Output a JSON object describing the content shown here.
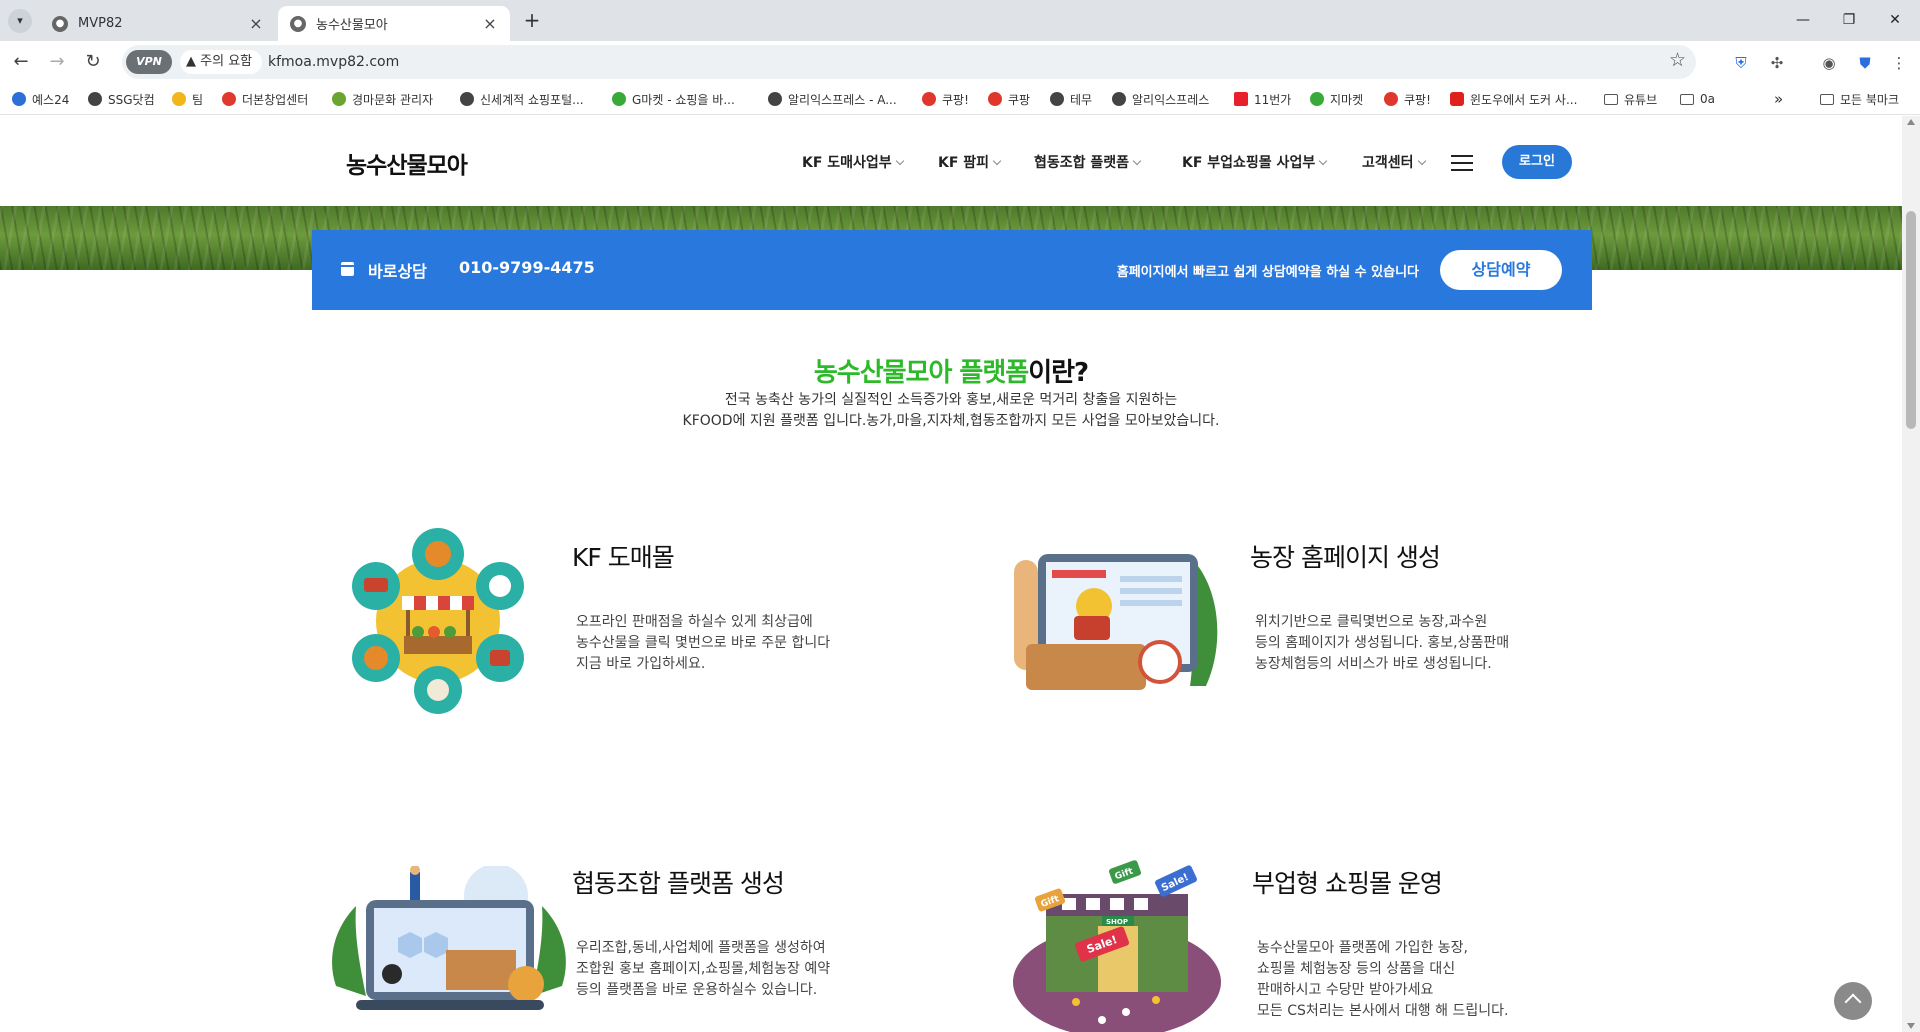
{
  "browser": {
    "tabs": [
      {
        "label": "MVP82",
        "active": false
      },
      {
        "label": "농수산물모아",
        "active": true
      }
    ],
    "address": {
      "vpn_label": "VPN",
      "security_label": "주의 요함",
      "url": "kfmoa.mvp82.com"
    },
    "bookmarks": [
      {
        "label": "예스24",
        "color": "#2d6fd6"
      },
      {
        "label": "SSG닷컴",
        "color": "#444444"
      },
      {
        "label": "팀",
        "color": "#f2b61b"
      },
      {
        "label": "더본창업센터",
        "color": "#e03a2e"
      },
      {
        "label": "경마문화 관리자",
        "color": "#6aa531"
      },
      {
        "label": "신세계적 쇼핑포털...",
        "color": "#444444"
      },
      {
        "label": "G마켓 - 쇼핑을 바...",
        "color": "#39a93a"
      },
      {
        "label": "알리익스프레스 - A...",
        "color": "#444444"
      },
      {
        "label": "쿠팡!",
        "color": "#e0372c"
      },
      {
        "label": "쿠팡",
        "color": "#e0372c"
      },
      {
        "label": "테무",
        "color": "#444444"
      },
      {
        "label": "알리익스프레스",
        "color": "#444444"
      },
      {
        "label": "11번가",
        "color": "#e8202c"
      },
      {
        "label": "지마켓",
        "color": "#39a93a"
      },
      {
        "label": "쿠팡!",
        "color": "#e0372c"
      },
      {
        "label": "윈도우에서 도커 사...",
        "color": "#e0201c"
      },
      {
        "label": "유튜브",
        "color": "folder"
      },
      {
        "label": "0a",
        "color": "folder"
      }
    ],
    "all_bookmarks_label": "모든 북마크",
    "more_label": "»"
  },
  "site": {
    "logo": "농수산물모아",
    "nav": [
      "KF 도매사업부",
      "KF 팜피",
      "협동조합 플랫폼",
      "KF 부업쇼핑몰 사업부",
      "고객센터"
    ],
    "login": "로그인"
  },
  "consult_bar": {
    "title": "바로상담",
    "phone": "010-9799-4475",
    "description": "홈페이지에서 빠르고 쉽게 상담예약을 하실 수 있습니다",
    "button": "상담예약"
  },
  "intro": {
    "title_highlight": "농수산물모아 플랫폼",
    "title_rest": "이란?",
    "line1": "전국 농축산 농가의 실질적인 소득증가와 홍보,새로운 먹거리 창출을 지원하는",
    "line2": "KFOOD에 지원 플랫폼 입니다.농가,마을,지자체,협동조합까지 모든 사업을 모아보았습니다."
  },
  "features": [
    {
      "title": "KF 도매몰",
      "desc": "오프라인  판매점을 하실수 있게  최상급에\n농수산물을 클릭 몇번으로 바로 주문 합니다\n지금 바로 가입하세요."
    },
    {
      "title": "농장 홈페이지 생성",
      "desc": "위치기반으로 클릭몇번으로 농장,과수원\n등의 홈페이지가 생성됩니다. 홍보,상품판매\n농장체험등의 서비스가 바로 생성됩니다."
    },
    {
      "title": "협동조합 플랫폼 생성",
      "desc": "우리조합,동네,사업체에  플랫폼을 생성하여\n조합원 홍보 홈페이지,쇼핑몰,체험농장 예약\n등의 플랫폼을 바로 운용하실수 있습니다."
    },
    {
      "title": "부업형 쇼핑몰 운영",
      "desc": "농수산물모아 플랫폼에 가입한 농장,\n쇼핑몰 체험농장 등의 상품을 대신\n판매하시고 수당만 받아가세요\n모든 CS처리는 본사에서 대행 해 드립니다."
    }
  ],
  "illustration_text": {
    "sale": "Sale!",
    "gift": "Gift",
    "shop": "SHOP"
  }
}
